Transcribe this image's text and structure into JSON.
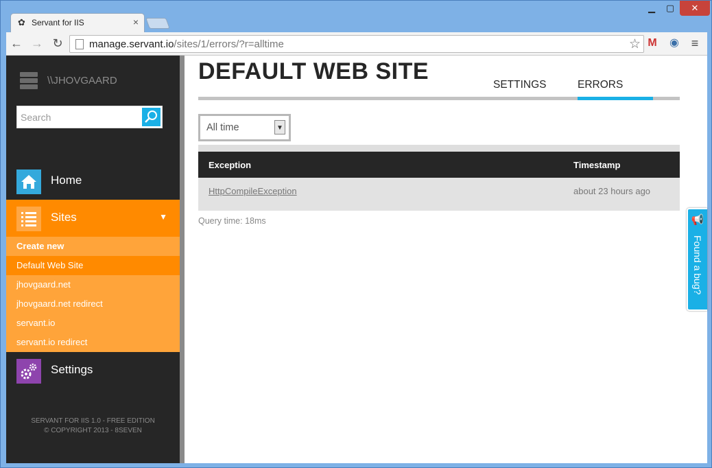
{
  "browser": {
    "tab_title": "Servant for IIS",
    "url_host": "manage.servant.io",
    "url_path": "/sites/1/errors/?r=alltime"
  },
  "sidebar": {
    "server_name": "\\\\JHOVGAARD",
    "search_placeholder": "Search",
    "nav": {
      "home": "Home",
      "sites": "Sites",
      "settings": "Settings"
    },
    "sites_submenu": [
      "Create new",
      "Default Web Site",
      "jhovgaard.net",
      "jhovgaard.net redirect",
      "servant.io",
      "servant.io redirect"
    ],
    "footer_line1": "SERVANT FOR IIS 1.0 - FREE EDITION",
    "footer_line2": "© COPYRIGHT 2013 - 8SEVEN"
  },
  "main": {
    "title": "DEFAULT WEB SITE",
    "tabs": {
      "settings": "SETTINGS",
      "errors": "ERRORS"
    },
    "filter_value": "All time",
    "table": {
      "headers": [
        "Exception",
        "Timestamp"
      ],
      "rows": [
        {
          "exception": "HttpCompileException",
          "timestamp": "about 23 hours ago"
        }
      ]
    },
    "query_time": "Query time: 18ms"
  },
  "feedback_tab": "Found a bug?",
  "colors": {
    "accent_blue": "#1ab0e6",
    "accent_orange": "#ff8a00",
    "sidebar_bg": "#262626"
  }
}
